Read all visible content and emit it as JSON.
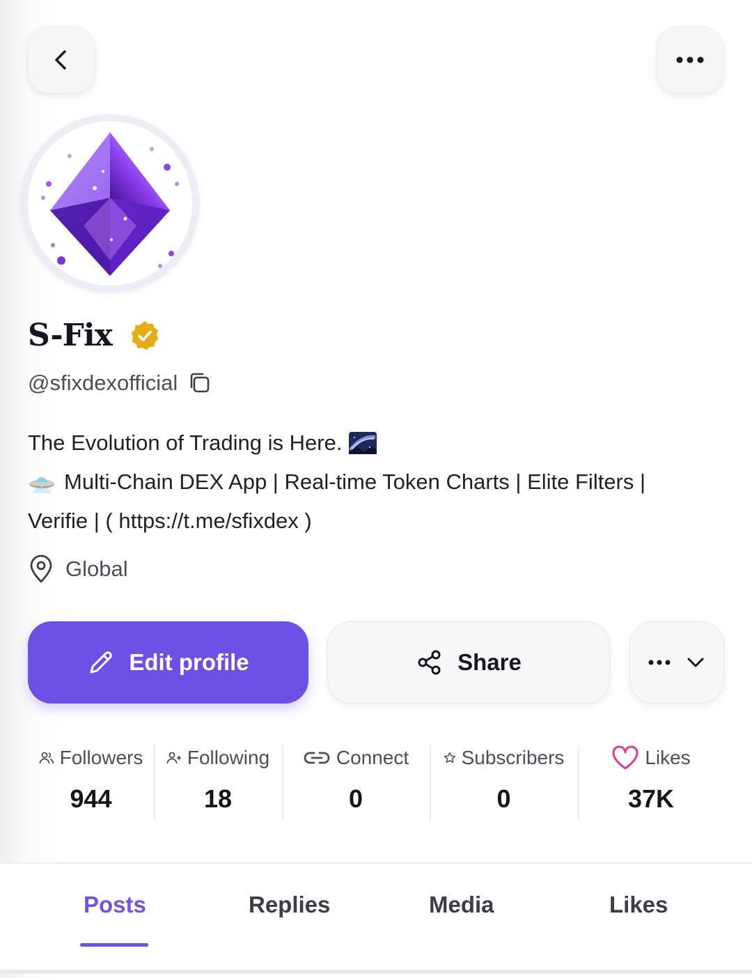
{
  "header": {
    "back_icon": "chevron-left-icon",
    "more_icon": "ellipsis-icon"
  },
  "profile": {
    "name": "S-Fix",
    "verified_icon": "verified-badge-icon",
    "verified_color": "#e6ac15",
    "handle": "@sfixdexofficial",
    "bio_line1": "The Evolution of Trading is Here.",
    "bio_line2": "Multi-Chain DEX App | Real-time Token Charts | Elite Filters |",
    "bio_line3": "Verifie | ( https://t.me/sfixdex )",
    "location": "Global"
  },
  "actions": {
    "edit_label": "Edit profile",
    "share_label": "Share",
    "accent": "#6c50e6"
  },
  "stats": [
    {
      "label": "Followers",
      "value": "944",
      "icon": "people-icon"
    },
    {
      "label": "Following",
      "value": "18",
      "icon": "person-add-icon"
    },
    {
      "label": "Connect",
      "value": "0",
      "icon": "link-icon"
    },
    {
      "label": "Subscribers",
      "value": "0",
      "icon": "star-icon"
    },
    {
      "label": "Likes",
      "value": "37K",
      "icon": "heart-icon",
      "icon_color": "#e0389a"
    }
  ],
  "tabs": [
    {
      "label": "Posts",
      "active": true
    },
    {
      "label": "Replies",
      "active": false
    },
    {
      "label": "Media",
      "active": false
    },
    {
      "label": "Likes",
      "active": false
    }
  ]
}
